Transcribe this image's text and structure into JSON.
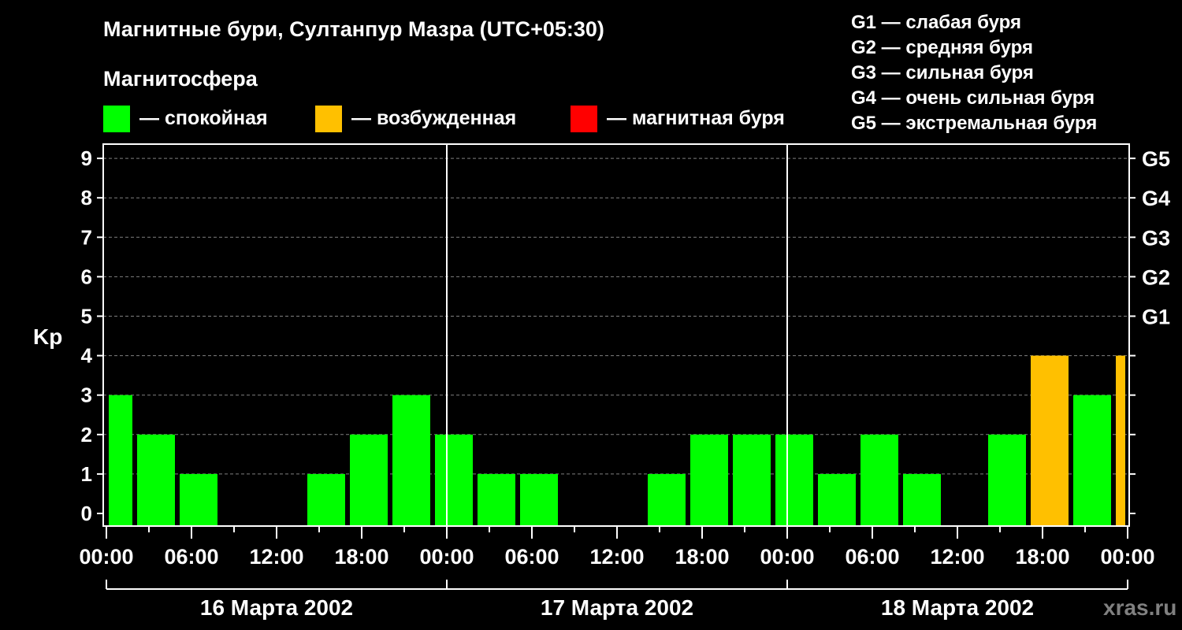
{
  "chart_data": {
    "type": "bar",
    "title": "Магнитные бури, Султанпур Мазра (UTC+05:30)",
    "subtitle": "Магнитосфера",
    "legend": [
      {
        "label": "— спокойная",
        "color": "#00ff00"
      },
      {
        "label": "— возбужденная",
        "color": "#ffc000"
      },
      {
        "label": "— магнитная буря",
        "color": "#ff0000"
      }
    ],
    "g_scale": [
      "G1 — слабая буря",
      "G2 — средняя буря",
      "G3 — сильная буря",
      "G4 — очень сильная буря",
      "G5 — экстремальная буря"
    ],
    "ylabel": "Kp",
    "ylim": [
      0,
      9
    ],
    "yticks": [
      "0",
      "1",
      "2",
      "3",
      "4",
      "5",
      "6",
      "7",
      "8",
      "9"
    ],
    "right_ticks": [
      {
        "kp": 5,
        "label": "G1"
      },
      {
        "kp": 6,
        "label": "G2"
      },
      {
        "kp": 7,
        "label": "G3"
      },
      {
        "kp": 8,
        "label": "G4"
      },
      {
        "kp": 9,
        "label": "G5"
      }
    ],
    "xticks": [
      "00:00",
      "06:00",
      "12:00",
      "18:00",
      "00:00",
      "06:00",
      "12:00",
      "18:00",
      "00:00",
      "06:00",
      "12:00",
      "18:00",
      "00:00"
    ],
    "days": [
      "16 Марта 2002",
      "17 Марта 2002",
      "18 Марта 2002"
    ],
    "x_range_hours": [
      0,
      72
    ],
    "bars": {
      "start_hours": [
        0,
        2,
        5,
        8,
        11,
        14,
        17,
        20,
        23,
        26,
        29,
        32,
        35,
        38,
        41,
        44,
        47,
        50,
        53,
        56,
        59,
        62,
        65,
        68,
        71
      ],
      "end_hours": [
        2,
        5,
        8,
        11,
        14,
        17,
        20,
        23,
        26,
        29,
        32,
        35,
        38,
        41,
        44,
        47,
        50,
        53,
        56,
        59,
        62,
        65,
        68,
        71,
        72
      ],
      "values": [
        3,
        2,
        1,
        0,
        0,
        1,
        2,
        3,
        2,
        1,
        1,
        0,
        0,
        1,
        2,
        2,
        2,
        1,
        2,
        1,
        0,
        2,
        4,
        3,
        4
      ]
    },
    "colors": {
      "quiet": "#00ff00",
      "active": "#ffc000",
      "storm": "#ff0000",
      "grid": "#808080"
    },
    "source": "xras.ru"
  }
}
